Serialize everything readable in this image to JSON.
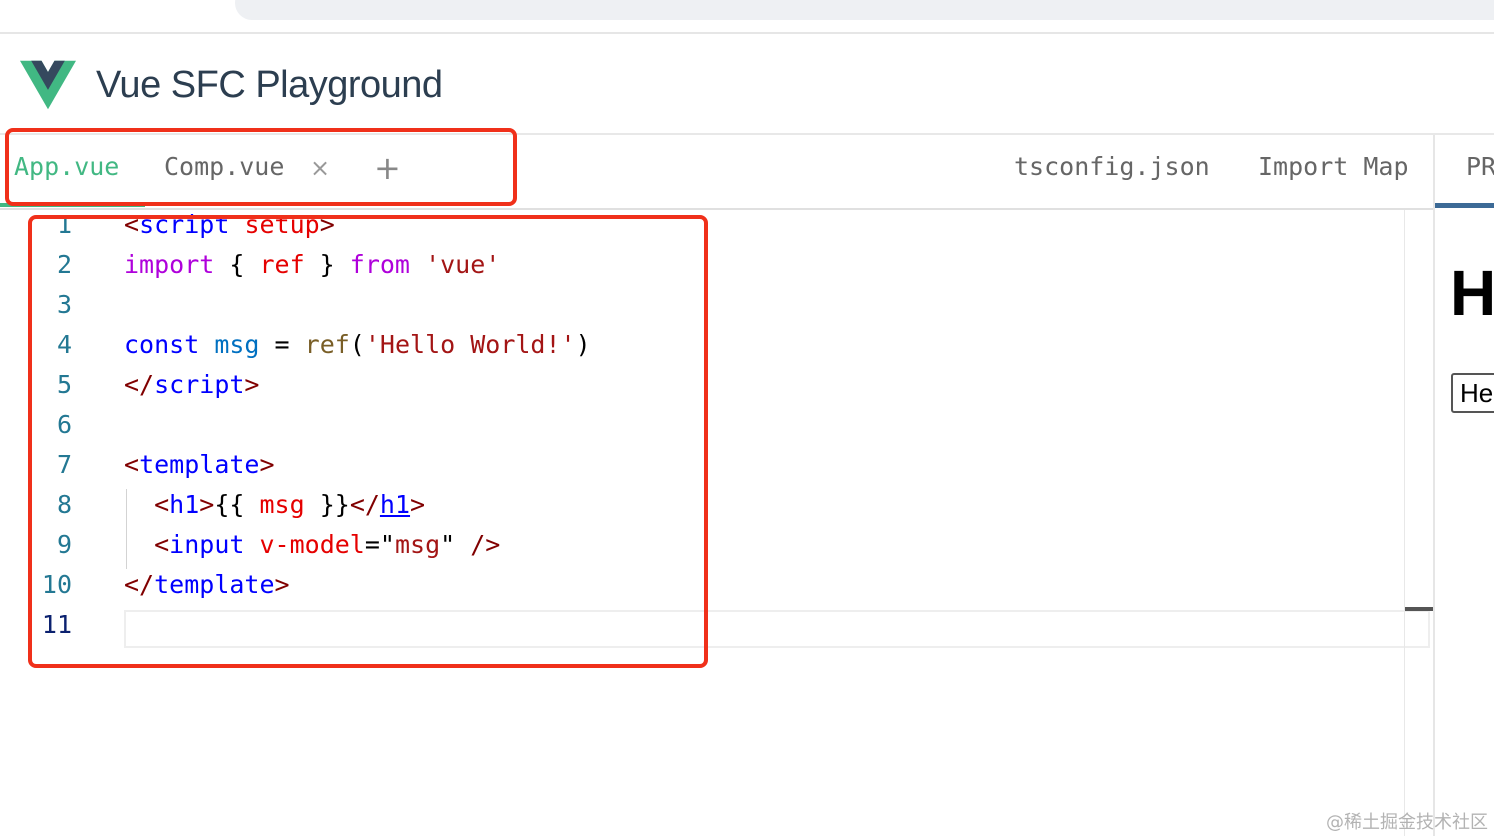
{
  "header": {
    "title": "Vue SFC Playground",
    "logo_colors": {
      "outer": "#41b883",
      "inner": "#35495e"
    }
  },
  "tabs": {
    "files": [
      {
        "label": "App.vue",
        "active": true
      },
      {
        "label": "Comp.vue",
        "active": false
      }
    ],
    "close_glyph": "×",
    "add_glyph": "+",
    "config": [
      {
        "label": "tsconfig.json"
      },
      {
        "label": "Import Map"
      }
    ]
  },
  "editor": {
    "line_numbers": [
      "1",
      "2",
      "3",
      "4",
      "5",
      "6",
      "7",
      "8",
      "9",
      "10",
      "11"
    ],
    "current_line": 11,
    "lines": [
      [
        {
          "t": "tag",
          "v": "<"
        },
        {
          "t": "name",
          "v": "script"
        },
        {
          "t": "plain",
          "v": " "
        },
        {
          "t": "attr",
          "v": "setup"
        },
        {
          "t": "tag",
          "v": ">"
        }
      ],
      [
        {
          "t": "kw",
          "v": "import"
        },
        {
          "t": "plain",
          "v": " { "
        },
        {
          "t": "attr",
          "v": "ref"
        },
        {
          "t": "plain",
          "v": " } "
        },
        {
          "t": "kw",
          "v": "from"
        },
        {
          "t": "plain",
          "v": " "
        },
        {
          "t": "str",
          "v": "'vue'"
        }
      ],
      [],
      [
        {
          "t": "decl",
          "v": "const"
        },
        {
          "t": "plain",
          "v": " "
        },
        {
          "t": "var",
          "v": "msg"
        },
        {
          "t": "plain",
          "v": " = "
        },
        {
          "t": "fn",
          "v": "ref"
        },
        {
          "t": "plain",
          "v": "("
        },
        {
          "t": "str",
          "v": "'Hello World!'"
        },
        {
          "t": "plain",
          "v": ")"
        }
      ],
      [
        {
          "t": "tag",
          "v": "</"
        },
        {
          "t": "name",
          "v": "script"
        },
        {
          "t": "tag",
          "v": ">"
        }
      ],
      [],
      [
        {
          "t": "tag",
          "v": "<"
        },
        {
          "t": "name",
          "v": "template"
        },
        {
          "t": "tag",
          "v": ">"
        }
      ],
      [
        {
          "t": "plain",
          "v": "  "
        },
        {
          "t": "tag",
          "v": "<"
        },
        {
          "t": "name",
          "v": "h1"
        },
        {
          "t": "tag",
          "v": ">"
        },
        {
          "t": "plain",
          "v": "{{ "
        },
        {
          "t": "interp",
          "v": "msg"
        },
        {
          "t": "plain",
          "v": " }}"
        },
        {
          "t": "tag",
          "v": "</"
        },
        {
          "t": "link",
          "v": "h1"
        },
        {
          "t": "tag",
          "v": ">"
        }
      ],
      [
        {
          "t": "plain",
          "v": "  "
        },
        {
          "t": "tag",
          "v": "<"
        },
        {
          "t": "name",
          "v": "input"
        },
        {
          "t": "plain",
          "v": " "
        },
        {
          "t": "attr",
          "v": "v-model"
        },
        {
          "t": "plain",
          "v": "=\""
        },
        {
          "t": "str",
          "v": "msg"
        },
        {
          "t": "plain",
          "v": "\" "
        },
        {
          "t": "tag",
          "v": "/>"
        }
      ],
      [
        {
          "t": "tag",
          "v": "</"
        },
        {
          "t": "name",
          "v": "template"
        },
        {
          "t": "tag",
          "v": ">"
        }
      ],
      []
    ]
  },
  "preview": {
    "tab_label": "PR",
    "h1_text": "H",
    "input_value": "He"
  },
  "annotation_color": "#f0301a",
  "watermark": "@稀土掘金技术社区"
}
